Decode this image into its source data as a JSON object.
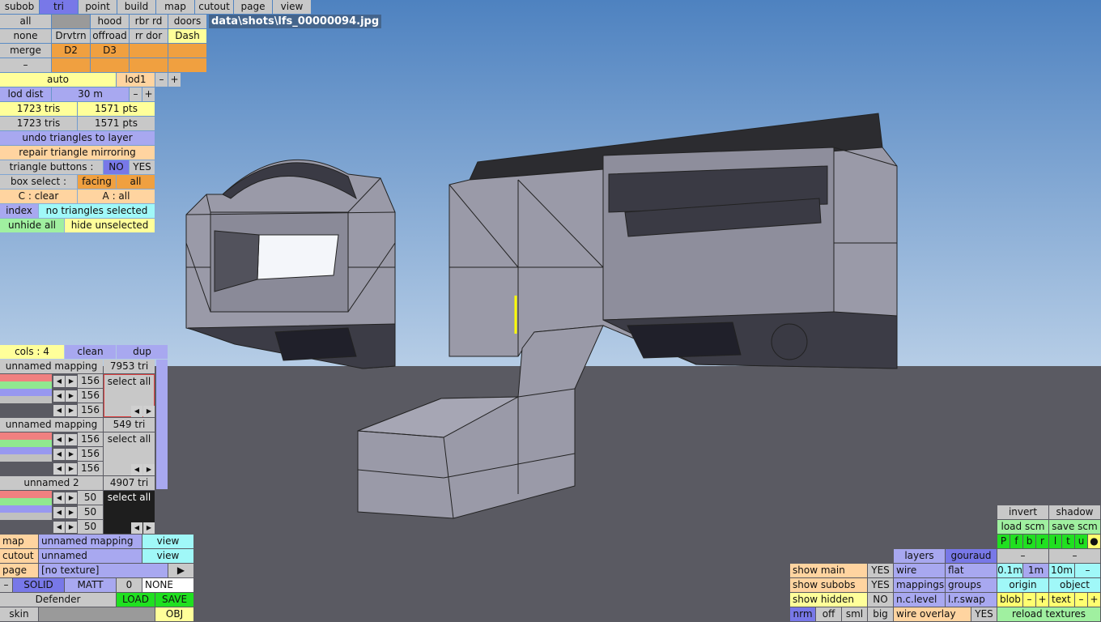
{
  "file_title": "data\\shots\\lfs_00000094.jpg",
  "top_row": [
    "subob",
    "tri",
    "point",
    "build",
    "map",
    "cutout",
    "page",
    "view"
  ],
  "row1": [
    "all",
    "",
    "hood",
    "rbr rd",
    "doors"
  ],
  "row2": [
    "none",
    "Drvtrn",
    "offroad",
    "rr dor",
    "Dash"
  ],
  "row3": [
    "merge",
    "D2",
    "D3",
    "",
    ""
  ],
  "row4": [
    "–",
    "",
    "",
    "",
    ""
  ],
  "lod": {
    "auto": "auto",
    "lod1": "lod1",
    "minus": "–",
    "plus": "+"
  },
  "lod_dist": {
    "label": "lod dist",
    "value": "30 m",
    "minus": "–",
    "plus": "+"
  },
  "counts": [
    {
      "tris": "1723 tris",
      "pts": "1571 pts"
    },
    {
      "tris": "1723 tris",
      "pts": "1571 pts"
    }
  ],
  "undo_triangles": "undo triangles to layer",
  "repair_mirroring": "repair triangle mirroring",
  "triangle_buttons": {
    "label": "triangle buttons :",
    "no": "NO",
    "yes": "YES"
  },
  "box_select": {
    "label": "box select :",
    "facing": "facing",
    "all": "all"
  },
  "clear_all": {
    "clear": "C : clear",
    "all": "A : all"
  },
  "index": {
    "label": "index",
    "status": "no triangles selected"
  },
  "unhide": {
    "unhide": "unhide all",
    "hide": "hide unselected"
  },
  "cols": {
    "label": "cols : 4",
    "clean": "clean",
    "dup": "dup"
  },
  "mappings": [
    {
      "name": "unnamed mapping",
      "tri": "7953 tri",
      "vals": [
        "156",
        "156",
        "156"
      ],
      "select": "select all"
    },
    {
      "name": "unnamed mapping",
      "tri": "549 tri",
      "vals": [
        "156",
        "156",
        "156"
      ],
      "select": "select all"
    },
    {
      "name": "unnamed 2",
      "tri": "4907 tri",
      "vals": [
        "50",
        "50",
        "50"
      ],
      "select": "select all"
    }
  ],
  "bottom_left": {
    "map_label": "map",
    "map_value": "unnamed mapping",
    "map_view": "view",
    "cutout_label": "cutout",
    "cutout_value": "unnamed",
    "cutout_view": "view",
    "page_label": "page",
    "page_value": "[no texture]",
    "page_arrow": "▶",
    "dash": "–",
    "solid": "SOLID",
    "matt": "MATT",
    "zero": "0",
    "none": "NONE",
    "defender": "Defender",
    "load": "LOAD",
    "save": "SAVE",
    "skin": "skin",
    "obj": "OBJ"
  },
  "bottom_right": {
    "invert": "invert",
    "shadow": "shadow",
    "load_scm": "load scm",
    "save_scm": "save scm",
    "letters": [
      "P",
      "f",
      "b",
      "r",
      "l",
      "t",
      "u",
      "●"
    ],
    "layers": "layers",
    "gouraud": "gouraud",
    "dash1": "–",
    "dash2": "–",
    "show_main": "show main",
    "show_main_val": "YES",
    "wire": "wire",
    "flat": "flat",
    "d01": "0.1m",
    "d1": "1m",
    "d10": "10m",
    "dminus": "–",
    "show_subobs": "show subobs",
    "show_subobs_val": "YES",
    "mappings": "mappings",
    "groups": "groups",
    "origin": "origin",
    "object": "object",
    "show_hidden": "show hidden",
    "show_hidden_val": "NO",
    "nclevel": "n.c.level",
    "lrswap": "l.r.swap",
    "blob": "blob",
    "blob_m": "–",
    "blob_p": "+",
    "text": "text",
    "text_m": "–",
    "text_p": "+",
    "nrm": "nrm",
    "off": "off",
    "sml": "sml",
    "big": "big",
    "wire_overlay": "wire overlay",
    "wire_overlay_val": "YES",
    "reload": "reload textures"
  }
}
